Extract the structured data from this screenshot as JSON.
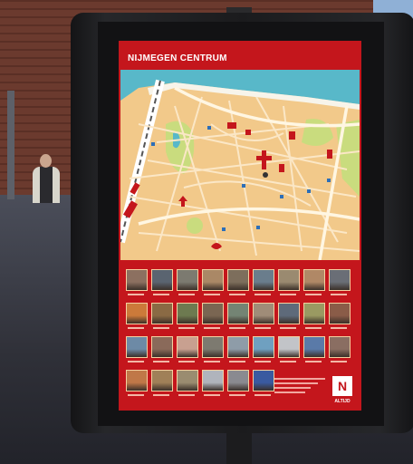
{
  "sign": {
    "title": "NIJMEGEN CENTRUM",
    "brand": "ALTIJD"
  },
  "colors": {
    "sign_red": "#c4161c",
    "map_water": "#58b8c9",
    "map_streets": "#f2c98a",
    "map_parks": "#c9dc7e",
    "frame": "#1b1b1d"
  },
  "gallery": {
    "rows": 4,
    "cols": 9,
    "tiles": [
      [
        "#8c7060",
        "#5a6470",
        "#7c7a70",
        "#aa8866",
        "#7d6e5c",
        "#6a7d8c",
        "#9a8a70",
        "#b08866",
        "#6a6e76"
      ],
      [
        "#cc7a3a",
        "#8a6a44",
        "#6d7a50",
        "#7a6652",
        "#748474",
        "#a08c78",
        "#5e6a7a",
        "#9a9a62",
        "#8a5c48"
      ],
      [
        "#6d8aa6",
        "#8a6a5a",
        "#c8a090",
        "#7d7a70",
        "#8e9ca8",
        "#6fa0c0",
        "#c2c4c8",
        "#5a7aa8",
        "#8a6e62"
      ],
      [
        "#c07848",
        "#a08058",
        "#9a8c70",
        "#b0b4bc",
        "#8a8a90",
        "#3a5aa0"
      ]
    ]
  }
}
